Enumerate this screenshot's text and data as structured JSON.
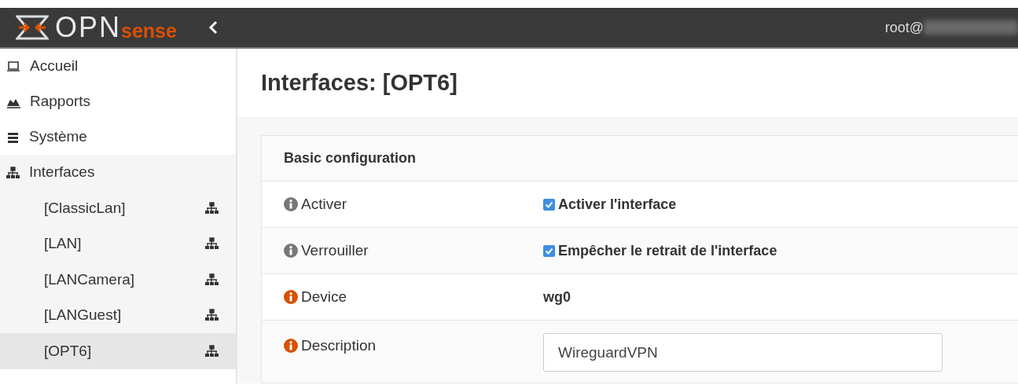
{
  "header": {
    "logo": {
      "text": "OPN",
      "brand": "sense"
    },
    "user": "root@"
  },
  "sidebar": {
    "items": [
      {
        "label": "Accueil"
      },
      {
        "label": "Rapports"
      },
      {
        "label": "Système"
      },
      {
        "label": "Interfaces",
        "children": [
          {
            "label": "[ClassicLan]",
            "selected": false
          },
          {
            "label": "[LAN]",
            "selected": false
          },
          {
            "label": "[LANCamera]",
            "selected": false
          },
          {
            "label": "[LANGuest]",
            "selected": false
          },
          {
            "label": "[OPT6]",
            "selected": true
          }
        ]
      }
    ]
  },
  "page": {
    "title": "Interfaces: [OPT6]"
  },
  "section": {
    "title": "Basic configuration",
    "rows": [
      {
        "label": "Activer",
        "color": "#777777",
        "kind": "checkbox",
        "checked": true,
        "text": "Activer l'interface"
      },
      {
        "label": "Verrouiller",
        "color": "#777777",
        "kind": "checkbox",
        "checked": true,
        "text": "Empêcher le retrait de l'interface"
      },
      {
        "label": "Device",
        "color": "#d94f00",
        "kind": "static",
        "text": "wg0"
      },
      {
        "label": "Description",
        "color": "#d94f00",
        "kind": "input",
        "text": "WireguardVPN"
      }
    ]
  }
}
